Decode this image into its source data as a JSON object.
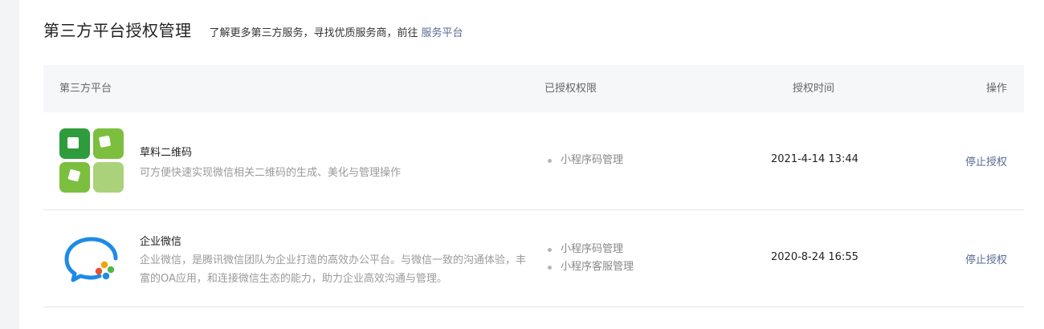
{
  "header": {
    "title": "第三方平台授权管理",
    "description": "了解更多第三方服务，寻找优质服务商，前往",
    "link_label": "服务平台"
  },
  "table": {
    "columns": [
      "第三方平台",
      "已授权权限",
      "授权时间",
      "操作"
    ],
    "rows": [
      {
        "name": "草料二维码",
        "description": "可方便快速实现微信相关二维码的生成、美化与管理操作",
        "permissions": [
          "小程序码管理"
        ],
        "time": "2021-4-14 13:44",
        "action": "停止授权",
        "icon": "caoliao-qrcode-logo"
      },
      {
        "name": "企业微信",
        "description": "企业微信，是腾讯微信团队为企业打造的高效办公平台。与微信一致的沟通体验，丰富的OA应用，和连接微信生态的能力，助力企业高效沟通与管理。",
        "permissions": [
          "小程序码管理",
          "小程序客服管理"
        ],
        "time": "2020-8-24 16:55",
        "action": "停止授权",
        "icon": "wecom-logo"
      }
    ]
  },
  "colors": {
    "link": "#576b95",
    "header_bg": "#f6f7f9",
    "caoliao_green_dark": "#2e9b3c",
    "caoliao_green_mid": "#7cbf3e",
    "caoliao_green_light": "#a9d27a",
    "wecom_blue": "#1e8be4"
  }
}
